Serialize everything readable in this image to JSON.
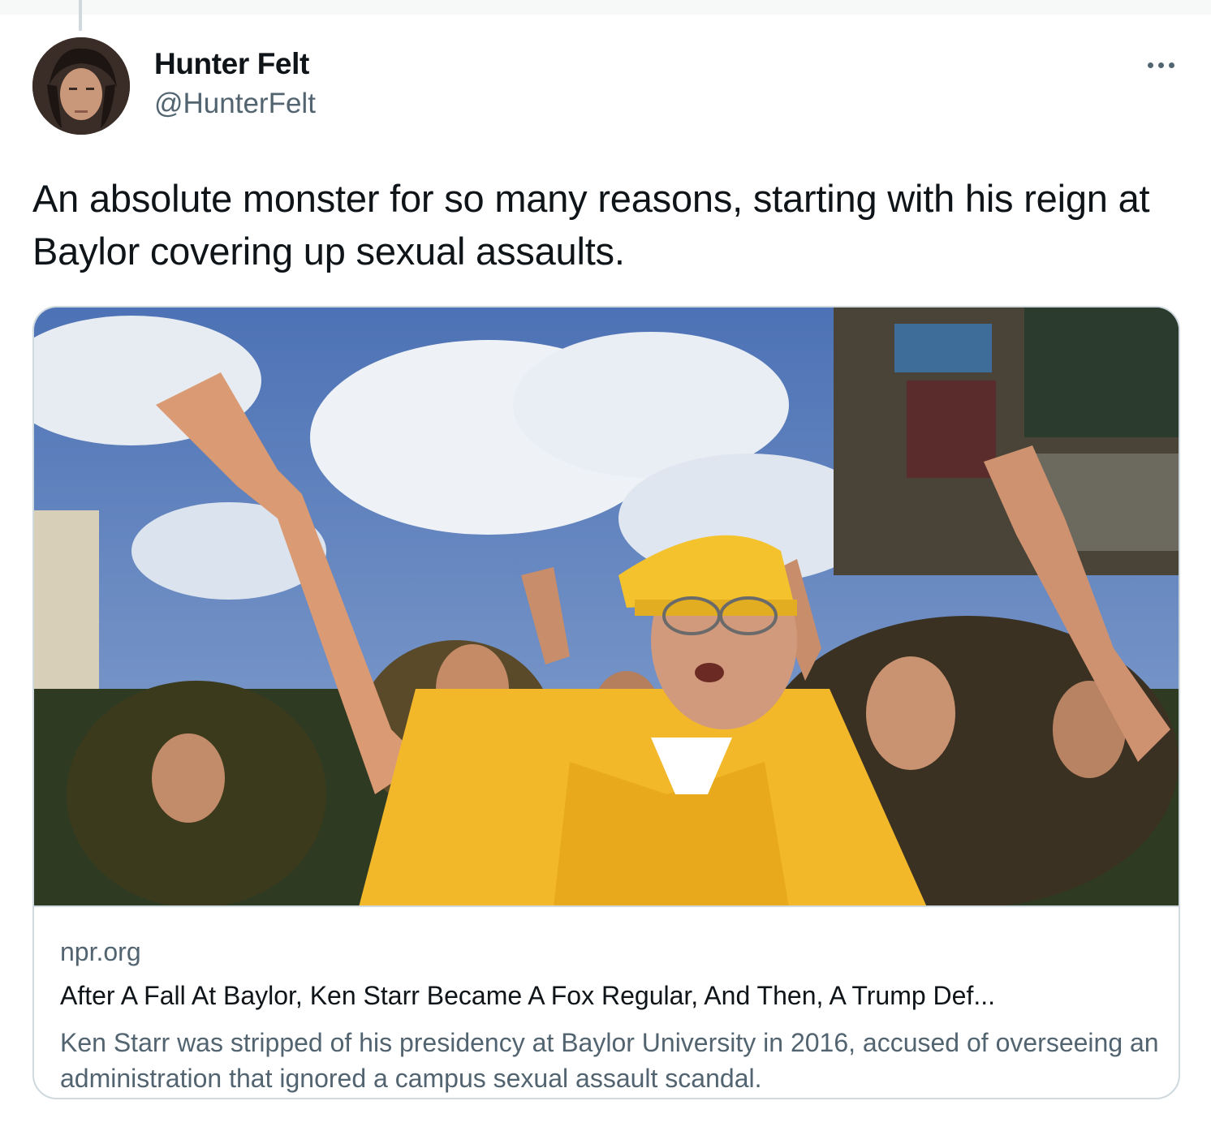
{
  "tweet": {
    "author_name": "Hunter Felt",
    "author_handle": "@HunterFelt",
    "text": "An absolute monster for so many reasons, starting with his reign at Baylor covering up sexual assaults.",
    "more_icon": "ellipsis-horizontal-icon"
  },
  "link_card": {
    "domain": "npr.org",
    "title": "After A Fall At Baylor, Ken Starr Became A Fox Regular, And Then, A Trump Def...",
    "description": "Ken Starr was stripped of his presidency at Baylor University in 2016, accused of overseeing an administration that ignored a campus sexual assault scandal.",
    "image_subject": "Man in yellow Baylor cap and jersey raising an arm among cheering students in a stadium"
  },
  "colors": {
    "text_primary": "#0f1419",
    "text_secondary": "#536471",
    "border": "#cfd9de",
    "baylor_gold": "#f2b82a",
    "baylor_green": "#1f3a22",
    "sky": "#5a7fc0"
  }
}
